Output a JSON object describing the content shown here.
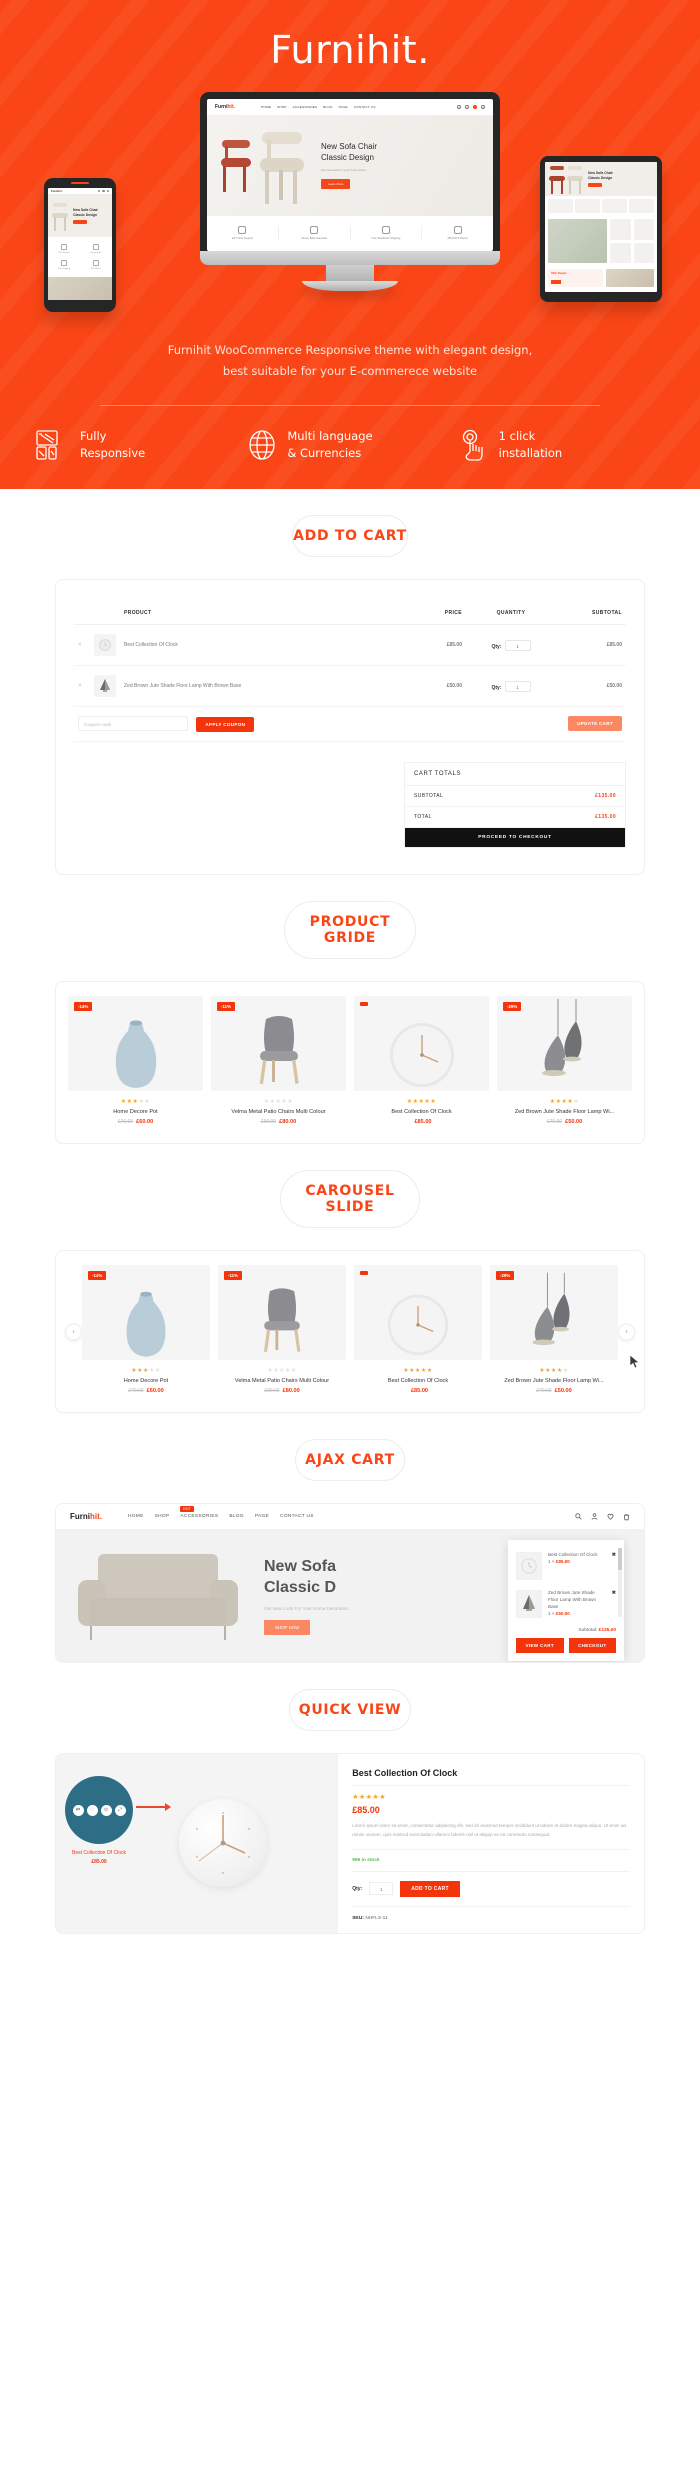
{
  "hero": {
    "brand": "Furnihit.",
    "description_line1": "Furnihit WooCommerce Responsive theme with elegant design,",
    "description_line2": "best suitable for your E-commerece website",
    "features": [
      {
        "icon": "responsive-devices-icon",
        "line1": "Fully",
        "line2": "Responsive"
      },
      {
        "icon": "globe-icon",
        "line1": "Multi language",
        "line2": "& Currencies"
      },
      {
        "icon": "click-hand-icon",
        "line1": "1 click",
        "line2": "installation"
      }
    ],
    "mockup": {
      "site_logo": "Furnihit.",
      "menu": [
        "HOME",
        "SHOP",
        "ACCESSORIES",
        "BLOG",
        "PAGE",
        "CONTACT US"
      ],
      "hero_title_l1": "New Sofa Chair",
      "hero_title_l2": "Classic Design",
      "hero_sub": "Get new look for your home decor",
      "hero_button": "Learn More",
      "features": [
        "24/7 Chat Support",
        "Money Back Garanted",
        "Free Worldwide Shipping",
        "365 DAYS Return"
      ],
      "promo_title": "Offer Design"
    },
    "accent_color": "#fa4616"
  },
  "sections": [
    {
      "id": "add-to-cart",
      "pill": "ADD TO CART"
    },
    {
      "id": "product-gride",
      "pill": "PRODUCT GRIDE"
    },
    {
      "id": "carousel-slide",
      "pill": "CAROUSEL SLIDE"
    },
    {
      "id": "ajax-cart",
      "pill": "AJAX CART"
    },
    {
      "id": "quick-view",
      "pill": "QUICK VIEW"
    }
  ],
  "cart": {
    "headers": [
      "PRODUCT",
      "PRICE",
      "QUANTITY",
      "SUBTOTAL"
    ],
    "rows": [
      {
        "remove": "×",
        "name": "Best Collection Of Clock",
        "price": "£85.00",
        "qty_label": "Qty:",
        "qty": "1",
        "subtotal": "£85.00",
        "thumb": "clock-thumb"
      },
      {
        "remove": "×",
        "name": "Zed Brown Jute Shade Floor Lamp With Brown Base",
        "price": "£50.00",
        "qty_label": "Qty:",
        "qty": "1",
        "subtotal": "£50.00",
        "thumb": "lamp-thumb"
      }
    ],
    "coupon_placeholder": "Coupon code",
    "apply_coupon": "APPLY COUPON",
    "update_cart": "UPDATE CART",
    "totals_title": "CART TOTALS",
    "subtotal_label": "SUBTOTAL",
    "subtotal_value": "£135.00",
    "total_label": "TOTAL",
    "total_value": "£135.00",
    "checkout": "PROCEED TO CHECKOUT"
  },
  "products": [
    {
      "badge": "-14%",
      "stars": 3,
      "name": "Home Decore Pot",
      "old_price": "£70.00",
      "new_price": "£60.00",
      "image": "vase"
    },
    {
      "badge": "-11%",
      "stars": 0,
      "name": "Velma Metal Patio Chairs Multi Colour",
      "old_price": "£90.00",
      "new_price": "£80.00",
      "image": "chair"
    },
    {
      "badge": "",
      "stars": 5,
      "name": "Best Collection Of Clock",
      "old_price": "",
      "new_price": "£85.00",
      "image": "clock"
    },
    {
      "badge": "-29%",
      "stars": 4,
      "name": "Zed Brown Jute Shade Floor Lamp Wi...",
      "old_price": "£70.00",
      "new_price": "£50.00",
      "image": "lamp"
    }
  ],
  "carousel": {
    "prev": "‹",
    "next": "›",
    "products": [
      {
        "badge": "-14%",
        "stars": 3,
        "name": "Home Decore Pot",
        "old_price": "£70.00",
        "new_price": "£60.00",
        "image": "vase"
      },
      {
        "badge": "-11%",
        "stars": 0,
        "name": "Velma Metal Patio Chairs Multi Colour",
        "old_price": "£90.00",
        "new_price": "£80.00",
        "image": "chair"
      },
      {
        "badge": "",
        "stars": 5,
        "name": "Best Collection Of Clock",
        "old_price": "",
        "new_price": "£85.00",
        "image": "clock"
      },
      {
        "badge": "-29%",
        "stars": 4,
        "name": "Zed Brown Jute Shade Floor Lamp Wi...",
        "old_price": "£70.00",
        "new_price": "£50.00",
        "image": "lamp"
      }
    ]
  },
  "ajax_cart": {
    "logo": "Furnihit.",
    "menu": [
      "HOME",
      "SHOP",
      "ACCESSORIES",
      "BLOG",
      "PAGE",
      "CONTACT US"
    ],
    "hot_badge": "HOT",
    "hero_title_l1": "New Sofa",
    "hero_title_l2": "Classic D",
    "hero_sub": "Get New Look For Your Home Decoration",
    "shop_now": "SHOP NOW",
    "items": [
      {
        "name": "Best Collection Of Clock",
        "qty_price": "1 × ",
        "price": "£85.00",
        "remove": "✖",
        "thumb": "clock-thumb"
      },
      {
        "name": "Zed Brown Jute Shade Floor Lamp With Brown Base",
        "qty_price": "1 × ",
        "price": "£50.00",
        "remove": "✖",
        "thumb": "lamp-thumb"
      }
    ],
    "subtotal_label": "Subtotal:",
    "subtotal_value": "£135.00",
    "view_cart": "VIEW CART",
    "checkout": "CHECKOUT"
  },
  "quick_view": {
    "thumb_caption": "Best Collection Of Clock",
    "thumb_price": "£85.00",
    "tools": [
      "⇄",
      "♡",
      "⊙",
      "⤢"
    ],
    "title": "Best Collection Of Clock",
    "stars": 5,
    "price": "£85.00",
    "description": "Lorem ipsum dolor sit amet, consectetur adipiscing elit, sed do eiusmod tempor incididunt ut labore et dolore magna aliqua. Ut enim ad minim veniam, quis nostrud exercitation ullamco laboris nisl ut aliquip ex ea commodo consequat.",
    "stock": "995 in stock",
    "qty_label": "Qty:",
    "qty": "1",
    "add_to_cart": "ADD TO CART",
    "sku_label": "SKU:",
    "sku_value": "NHFLS-11"
  }
}
